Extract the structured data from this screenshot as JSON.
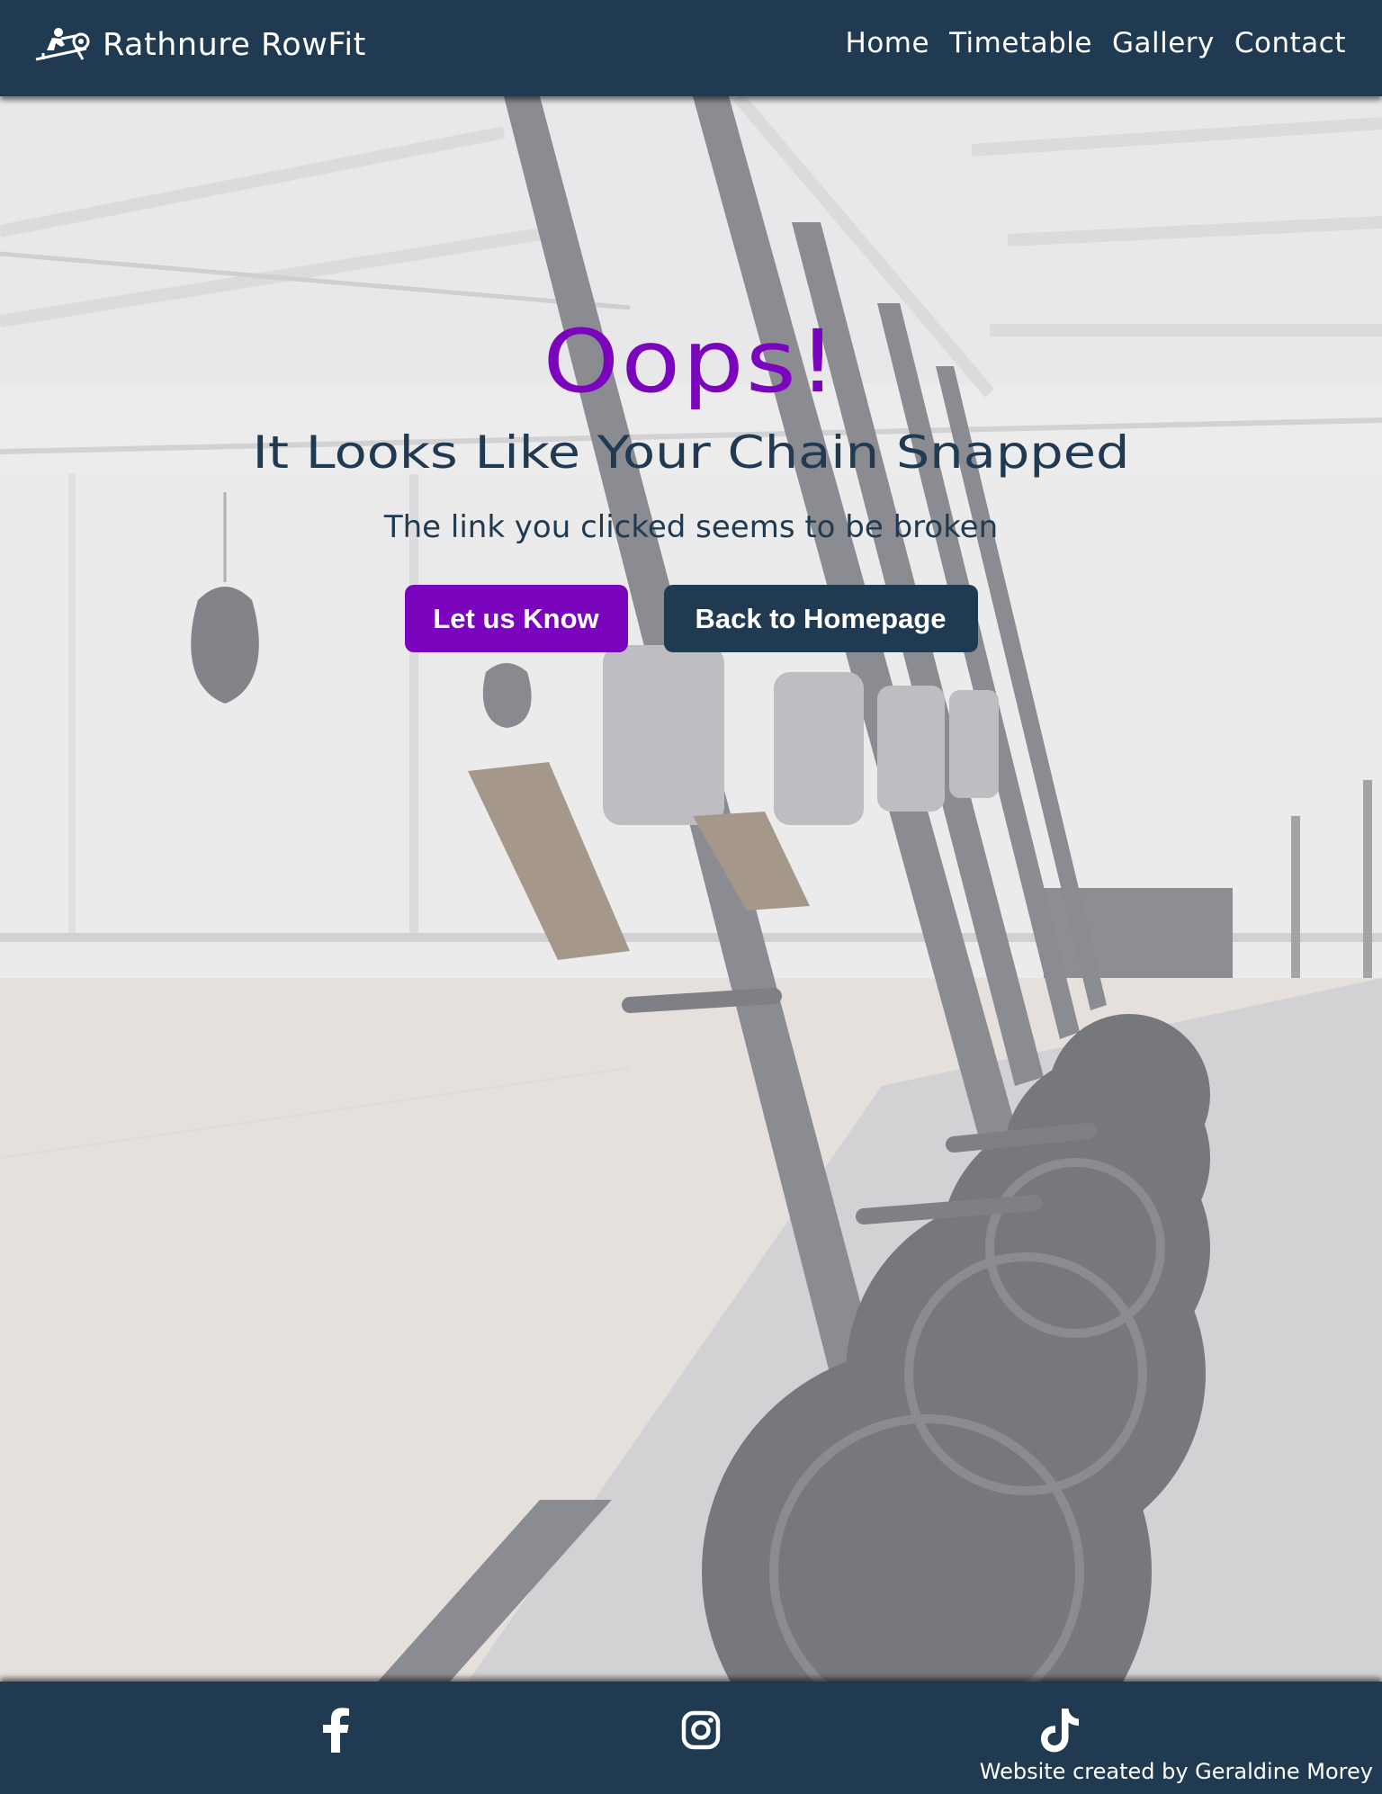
{
  "header": {
    "brand_name": "Rathnure RowFit",
    "logo_icon": "rowing-machine-icon",
    "nav": [
      {
        "label": "Home"
      },
      {
        "label": "Timetable"
      },
      {
        "label": "Gallery"
      },
      {
        "label": "Contact"
      }
    ]
  },
  "hero": {
    "background": "photo of row of rowing machines in gym",
    "title": "Oops!",
    "headline": "It Looks Like Your Chain Snapped",
    "subline": "The link you clicked seems to be broken",
    "buttons": {
      "report_label": "Let us Know",
      "home_label": "Back to Homepage"
    }
  },
  "footer": {
    "social": [
      {
        "icon": "facebook-icon"
      },
      {
        "icon": "instagram-icon"
      },
      {
        "icon": "tiktok-icon"
      }
    ],
    "credit": "Website created by Geraldine Morey"
  },
  "colors": {
    "navy": "#203a51",
    "accent_purple": "#7a05bd",
    "text_light": "#ffffff"
  }
}
